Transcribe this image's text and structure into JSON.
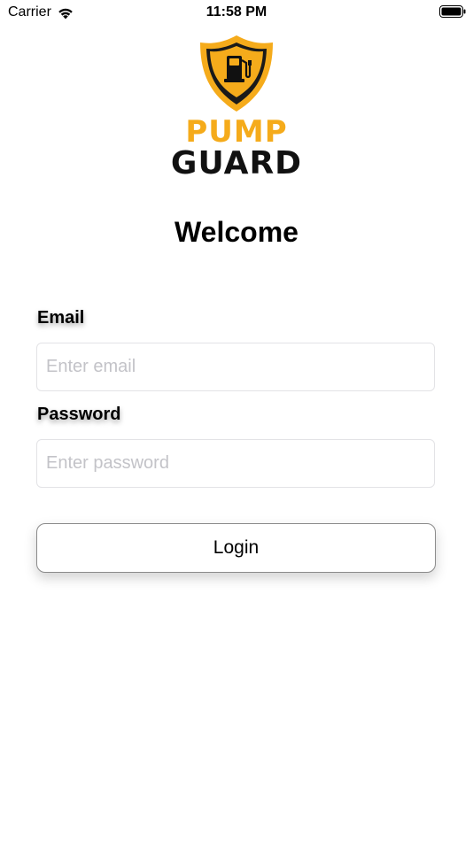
{
  "status_bar": {
    "carrier": "Carrier",
    "time": "11:58 PM"
  },
  "logo": {
    "brand_top": "PUMP",
    "brand_bottom": "GUARD",
    "icon": "shield-fuel-pump-icon"
  },
  "heading": "Welcome",
  "form": {
    "email_label": "Email",
    "email_placeholder": "Enter email",
    "email_value": "",
    "password_label": "Password",
    "password_placeholder": "Enter password",
    "password_value": "",
    "login_label": "Login"
  },
  "colors": {
    "brand_orange": "#f5ab1b",
    "brand_dark": "#111111"
  }
}
